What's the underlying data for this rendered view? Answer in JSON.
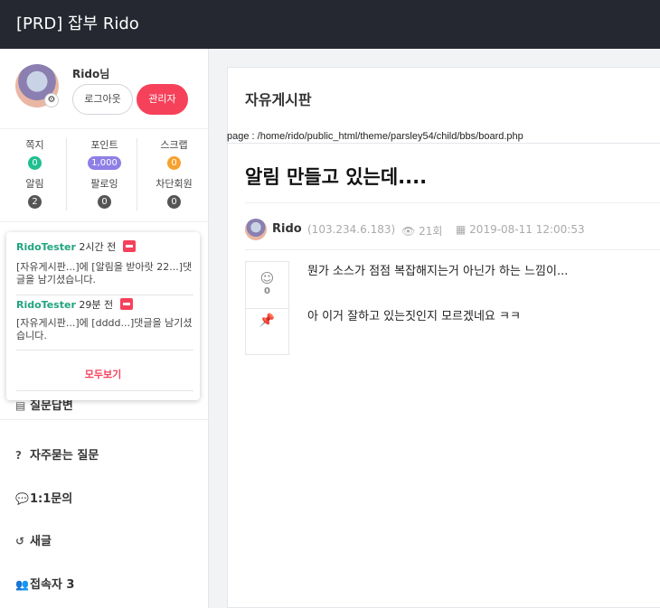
{
  "topbar": {
    "title": "[PRD] 잡부 Rido"
  },
  "profile": {
    "username": "Rido님",
    "logout_label": "로그아웃",
    "admin_label": "관리자"
  },
  "stats": [
    {
      "label": "쪽지",
      "value": "0",
      "color": "#1fbf8f"
    },
    {
      "label": "포인트",
      "value": "1,000",
      "color": "#8e7fe6"
    },
    {
      "label": "스크랩",
      "value": "0",
      "color": "#f7a12f"
    },
    {
      "label": "알림",
      "value": "2",
      "color": "#555555"
    },
    {
      "label": "팔로잉",
      "value": "0",
      "color": "#555555"
    },
    {
      "label": "차단회원",
      "value": "0",
      "color": "#555555"
    }
  ],
  "notifications": {
    "items": [
      {
        "who": "RidoTester",
        "when": "2시간 전",
        "text": "[자유게시판...]에 [알림을 받아랏 22...]댓글을 남기셨습니다."
      },
      {
        "who": "RidoTester",
        "when": "29분 전",
        "text": "[자유게시판...]에 [dddd...]댓글을 남기셨습니다."
      }
    ],
    "see_all": "모두보기"
  },
  "menu": {
    "partial": "질문답변",
    "faq": "자주묻는 질문",
    "inquiry": "1:1문의",
    "new_posts": "새글",
    "visitors": "접속자 3"
  },
  "board": {
    "title": "자유게시판",
    "path": "page : /home/rido/public_html/theme/parsley54/child/bbs/board.php"
  },
  "post": {
    "title": "알림 만들고 있는데....",
    "author": "Rido",
    "ip": "(103.234.6.183)",
    "views": "21회",
    "date": "2019-08-11 12:00:53",
    "likes": "0",
    "body": [
      "뭔가 소스가 점점 복잡해지는거 아닌가 하는 느낌이...",
      "아 이거 잘하고 있는짓인지 모르겠네요 ㅋㅋ"
    ]
  },
  "colors": {
    "accent": "#f6415b",
    "topbar": "#252830",
    "author_green": "#21a57e"
  }
}
